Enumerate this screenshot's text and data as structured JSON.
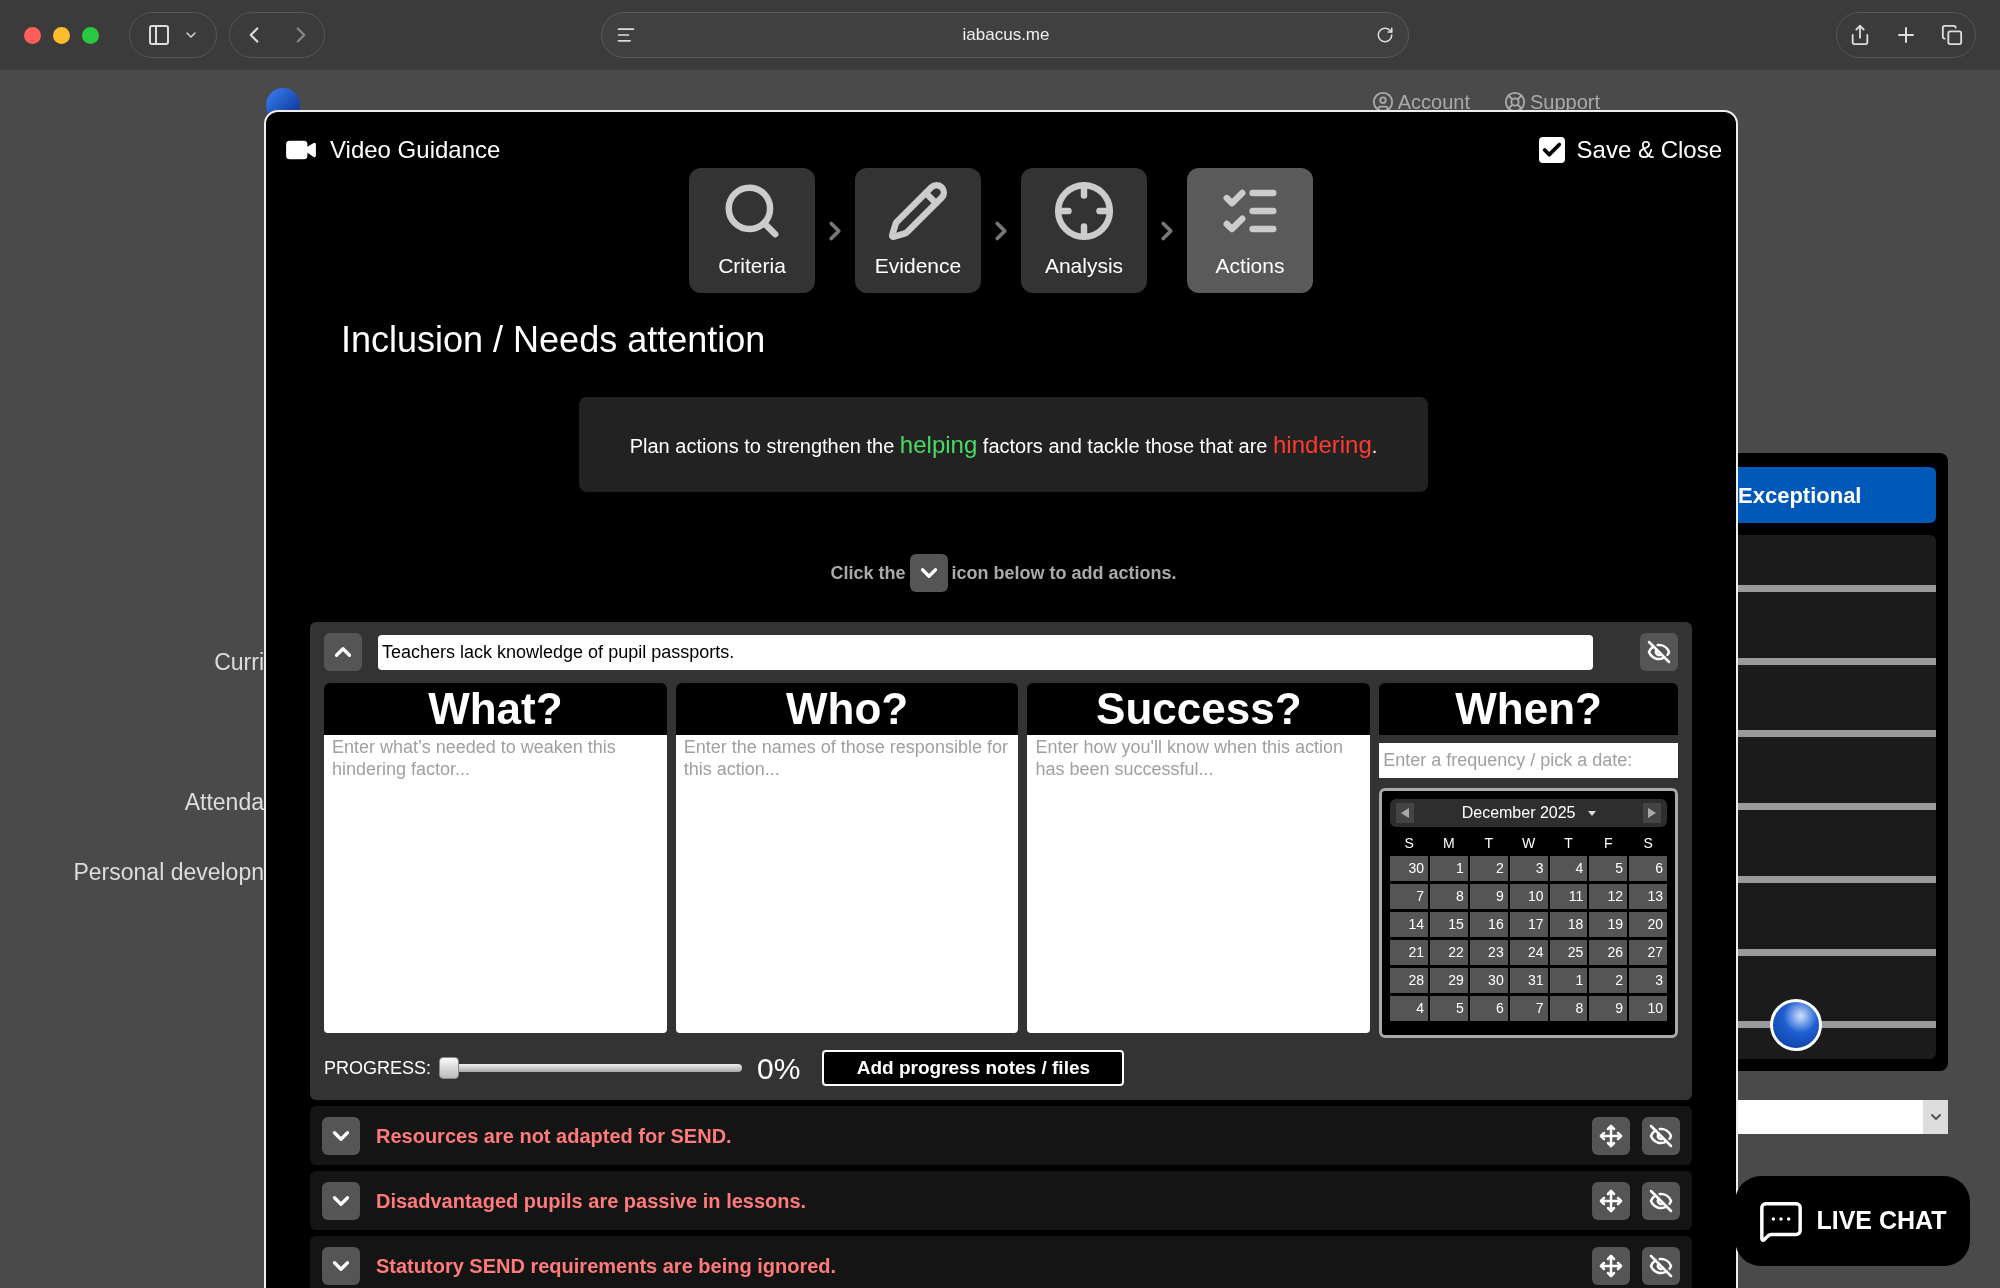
{
  "browser": {
    "url": "iabacus.me"
  },
  "site": {
    "links": [
      "Account",
      "Support"
    ],
    "side_labels": [
      "Curri",
      "Attenda",
      "Personal developn"
    ],
    "rating": {
      "label": "Exceptional",
      "level": 0
    },
    "live_chat": "LIVE CHAT"
  },
  "modal": {
    "title": "Video Guidance",
    "save": "Save & Close",
    "steps": [
      {
        "label": "Criteria",
        "selected": false
      },
      {
        "label": "Evidence",
        "selected": false
      },
      {
        "label": "Analysis",
        "selected": false
      },
      {
        "label": "Actions",
        "selected": true
      }
    ],
    "heading": "Inclusion / Needs attention",
    "info": [
      {
        "text": "Plan actions to strengthen the ",
        "kind": "plain"
      },
      {
        "text": "helping",
        "kind": "helping"
      },
      {
        "text": " factors and tackle those that are ",
        "kind": "plain"
      },
      {
        "text": "hindering",
        "kind": "hindering"
      },
      {
        "text": ".",
        "kind": "plain"
      }
    ],
    "hint": {
      "before": "Click the",
      "after": "icon below to add actions."
    },
    "factors": [
      {
        "title": "Teachers lack knowledge of pupil passports.",
        "expanded": true,
        "columns": [
          {
            "heading": "What?",
            "placeholder": "Enter what’s needed to weaken this hindering factor..."
          },
          {
            "heading": "Who?",
            "placeholder": "Enter the names of those responsible for this action..."
          },
          {
            "heading": "Success?",
            "placeholder": "Enter how you'll know when this action has been successful..."
          }
        ],
        "when": {
          "heading": "When?",
          "placeholder": "Enter a frequency / pick a date:",
          "calendar": {
            "month": "December 2025",
            "weekdays": [
              "S",
              "M",
              "T",
              "W",
              "T",
              "F",
              "S"
            ],
            "weeks": [
              [
                "30",
                "1",
                "2",
                "3",
                "4",
                "5",
                "6"
              ],
              [
                "7",
                "8",
                "9",
                "10",
                "11",
                "12",
                "13"
              ],
              [
                "14",
                "15",
                "16",
                "17",
                "18",
                "19",
                "20"
              ],
              [
                "21",
                "22",
                "23",
                "24",
                "25",
                "26",
                "27"
              ],
              [
                "28",
                "29",
                "30",
                "31",
                "1",
                "2",
                "3"
              ],
              [
                "4",
                "5",
                "6",
                "7",
                "8",
                "9",
                "10"
              ]
            ]
          }
        },
        "progress": {
          "label": "PROGRESS:",
          "level": 0,
          "reading": "0%",
          "button": "Add progress notes / files"
        }
      },
      {
        "title": "Resources are not adapted for SEND.",
        "expanded": false
      },
      {
        "title": "Disadvantaged pupils are passive in lessons.",
        "expanded": false
      },
      {
        "title": "Statutory SEND requirements are being ignored.",
        "expanded": false
      }
    ]
  }
}
